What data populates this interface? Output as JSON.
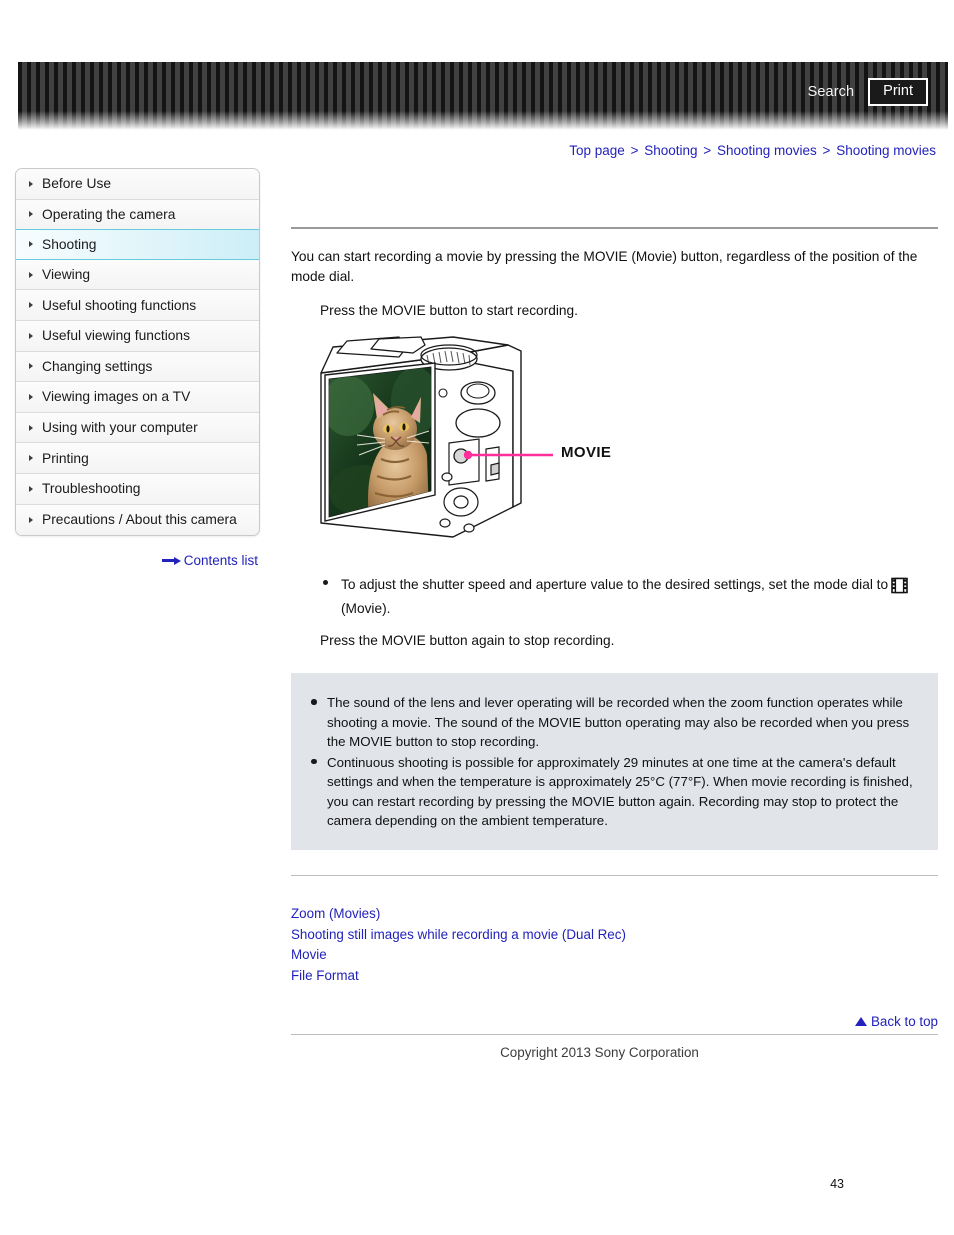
{
  "header": {
    "search_label": "Search",
    "print_label": "Print"
  },
  "breadcrumb": {
    "separator": ">",
    "items": [
      {
        "label": "Top page"
      },
      {
        "label": "Shooting"
      },
      {
        "label": "Shooting movies"
      },
      {
        "label": "Shooting movies"
      }
    ]
  },
  "sidebar": {
    "items": [
      {
        "label": "Before Use",
        "active": false
      },
      {
        "label": "Operating the camera",
        "active": false
      },
      {
        "label": "Shooting",
        "active": true
      },
      {
        "label": "Viewing",
        "active": false
      },
      {
        "label": "Useful shooting functions",
        "active": false
      },
      {
        "label": "Useful viewing functions",
        "active": false
      },
      {
        "label": "Changing settings",
        "active": false
      },
      {
        "label": "Viewing images on a TV",
        "active": false
      },
      {
        "label": "Using with your computer",
        "active": false
      },
      {
        "label": "Printing",
        "active": false
      },
      {
        "label": "Troubleshooting",
        "active": false
      },
      {
        "label": "Precautions / About this camera",
        "active": false
      }
    ],
    "contents_list_label": "Contents list"
  },
  "main": {
    "intro": "You can start recording a movie by pressing the MOVIE (Movie) button, regardless of the position of the mode dial.",
    "step1": "Press the MOVIE button to start recording.",
    "figure": {
      "callout_label": "MOVIE",
      "callout_color": "#ff2e9a",
      "lcd_subject": "cat-photo"
    },
    "bullet_before_icon": "To adjust the shutter speed and aperture value to the desired settings, set the mode dial to",
    "bullet_after_icon": "(Movie).",
    "step2": "Press the MOVIE button again to stop recording.",
    "notes": [
      "The sound of the lens and lever operating will be recorded when the zoom function operates while shooting a movie. The sound of the MOVIE button operating may also be recorded when you press the MOVIE button to stop recording.",
      "Continuous shooting is possible for approximately 29 minutes at one time at the camera's default settings and when the temperature is approximately 25°C (77°F). When movie recording is finished, you can restart recording by pressing the MOVIE button again. Recording may stop to protect the camera depending on the ambient temperature."
    ],
    "related_links": [
      {
        "label": "Zoom (Movies)"
      },
      {
        "label": "Shooting still images while recording a movie (Dual Rec)"
      },
      {
        "label": "Movie"
      },
      {
        "label": "File Format"
      }
    ]
  },
  "footer": {
    "back_to_top_label": "Back to top",
    "copyright": "Copyright 2013 Sony Corporation",
    "page_number": "43"
  },
  "colors": {
    "link": "#2222bb",
    "accent_highlight": "#cdeef7",
    "highlight_border": "#66ccdd",
    "note_background": "#e1e5ea"
  }
}
